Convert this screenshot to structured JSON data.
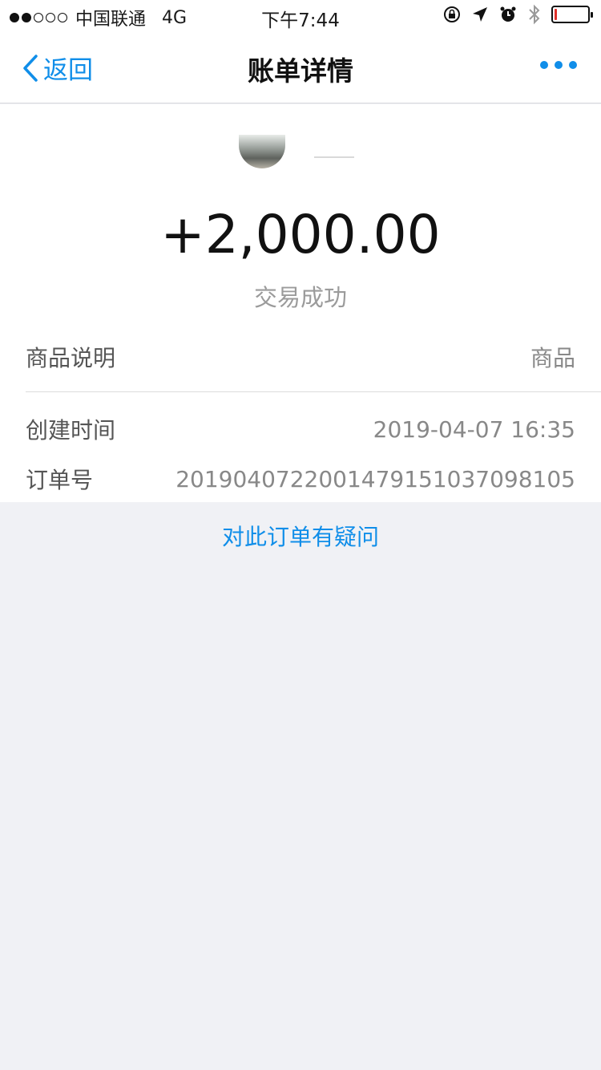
{
  "status_bar": {
    "carrier": "中国联通",
    "network": "4G",
    "time": "下午7:44",
    "signal_strength_dots": 2,
    "battery_level": 0.08
  },
  "navbar": {
    "back_label": "返回",
    "title": "账单详情",
    "more_icon": "more-dots-icon"
  },
  "bill": {
    "amount": "+2,000.00",
    "status": "交易成功",
    "rows": [
      {
        "label": "商品说明",
        "value": "商品"
      },
      {
        "label": "创建时间",
        "value": "2019-04-07 16:35"
      },
      {
        "label": "订单号",
        "value": "20190407220014791510370981 05"
      }
    ]
  },
  "question_link": "对此订单有疑问",
  "colors": {
    "accent": "#108ee9",
    "background": "#f0f1f5",
    "battery_low": "#e0302a"
  }
}
